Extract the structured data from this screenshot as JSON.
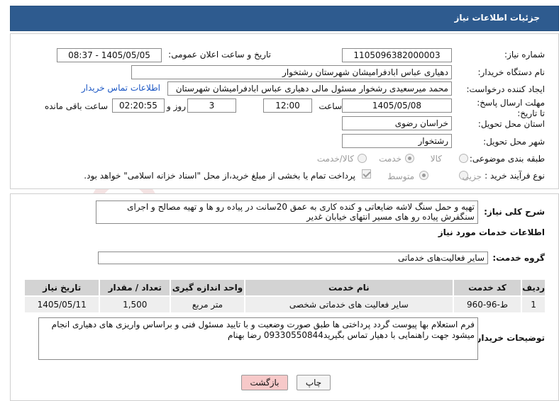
{
  "header": {
    "title": "جزئیات اطلاعات نیاز"
  },
  "form": {
    "need_number_label": "شماره نیاز:",
    "need_number": "1105096382000003",
    "announce_label": "تاریخ و ساعت اعلان عمومی:",
    "announce_value": "1405/05/05 - 08:37",
    "buyer_org_label": "نام دستگاه خریدار:",
    "buyer_org": "دهیاری عباس ابادفرامیشان شهرستان رشتخوار",
    "requester_label": "ایجاد کننده درخواست:",
    "requester": "محمد میرسعیدی رشخوار مسئول مالی دهیاری عباس ابادفرامیشان شهرستان",
    "contact_link": "اطلاعات تماس خریدار",
    "deadline_label": "مهلت ارسال پاسخ: تا تاریخ:",
    "deadline_date": "1405/05/08",
    "time_label": "ساعت",
    "deadline_time": "12:00",
    "days_value": "3",
    "days_label": "روز و",
    "remaining_time": "02:20:55",
    "remaining_label": "ساعت باقی مانده",
    "province_label": "استان محل تحویل:",
    "province": "خراسان رضوی",
    "city_label": "شهر محل تحویل:",
    "city": "رشتخوار",
    "category_label": "طبقه بندی موضوعی:",
    "category_options": [
      "کالا",
      "خدمت",
      "کالا/خدمت"
    ],
    "category_selected": "خدمت",
    "purchase_label": "نوع فرآیند خرید :",
    "purchase_options": [
      "جزیی",
      "متوسط"
    ],
    "purchase_selected": "متوسط",
    "payment_note": "پرداخت تمام یا بخشی از مبلغ خرید،از محل \"اسناد خزانه اسلامی\" خواهد بود."
  },
  "description": {
    "label": "شرح کلی نیاز:",
    "text": "تهیه  و حمل سنگ لاشه ضایعاتی و کنده کاری به عمق 20سانت در پیاده رو ها  و تهیه مصالح و اجرای سنگفرش پیاده رو های مسیر انتهای خیابان غدیر"
  },
  "services": {
    "section_title": "اطلاعات خدمات مورد نیاز",
    "group_label": "گروه خدمت:",
    "group_value": "سایر فعالیت‌های خدماتی",
    "columns": [
      "ردیف",
      "کد خدمت",
      "نام خدمت",
      "واحد اندازه گیری",
      "تعداد / مقدار",
      "تاریخ نیاز"
    ],
    "rows": [
      {
        "row": "1",
        "code": "ط-96-960",
        "name": "سایر فعالیت های خدماتی شخصی",
        "unit": "متر مربع",
        "qty": "1,500",
        "date": "1405/05/11"
      }
    ]
  },
  "buyer_notes": {
    "label": "توضیحات خریدار:",
    "text": "فرم استعلام بها پیوست گردد پرداختی ها طبق صورت وضعیت و با تایید مسئول فنی و براساس واریزی های دهیاری انجام میشود  جهت راهنمایی با دهیار تماس بگیرید09330550844 رضا بهنام"
  },
  "buttons": {
    "print": "چاپ",
    "back": "بازگشت"
  },
  "watermark_text": "AriaTender.net",
  "colors": {
    "header_bg": "#2e5b8f",
    "link": "#1a56c4",
    "back_button_bg": "#f7c9c9"
  }
}
